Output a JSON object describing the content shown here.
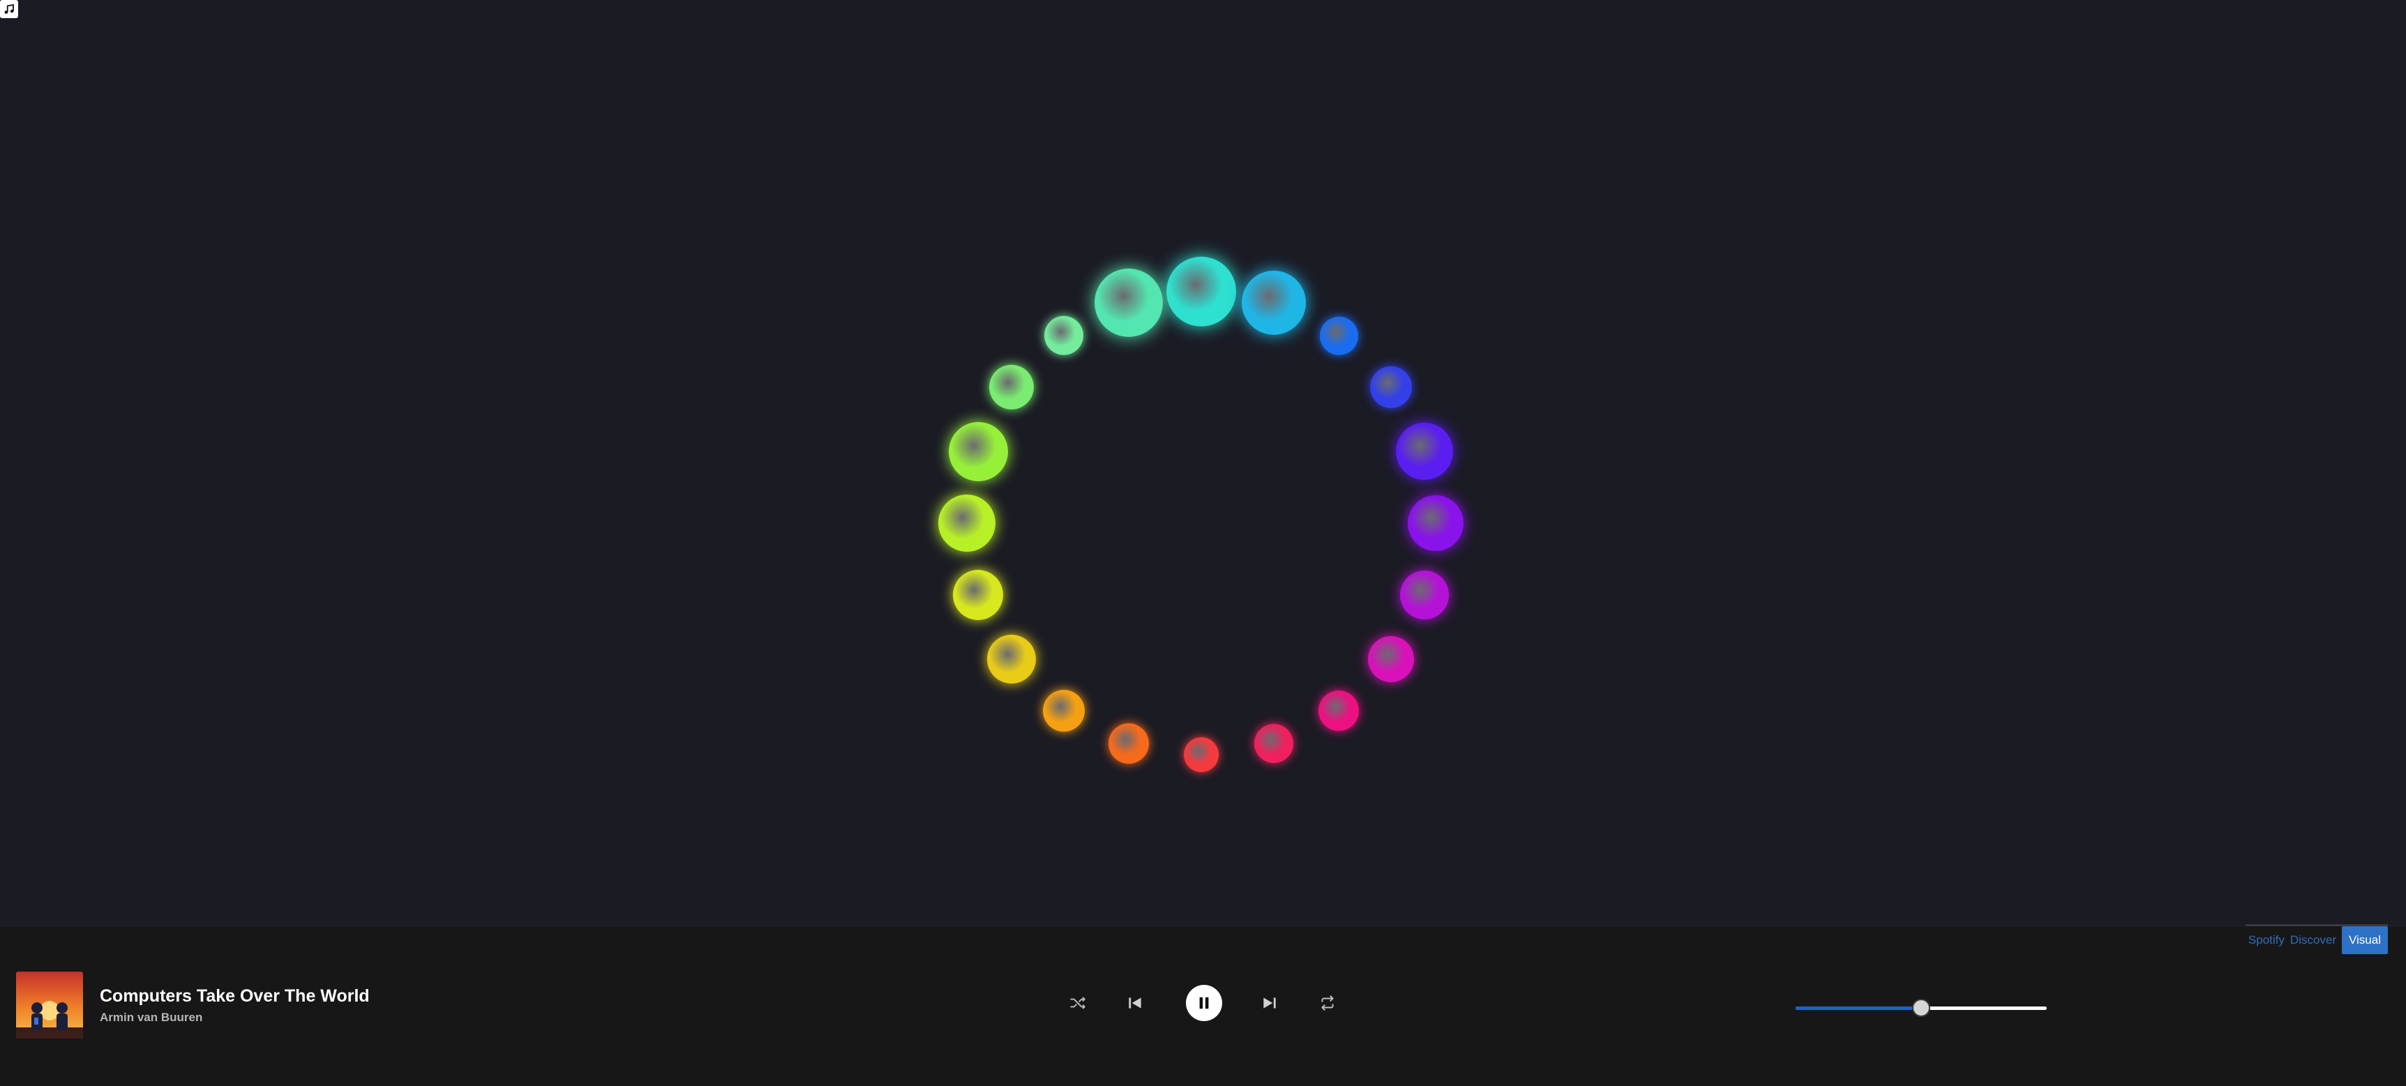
{
  "tabs": [
    {
      "label": "Spotify",
      "active": false
    },
    {
      "label": "Discover",
      "active": false
    },
    {
      "label": "Visual",
      "active": true
    }
  ],
  "now_playing": {
    "title": "Computers Take Over The World",
    "artist": "Armin van Buuren",
    "cover_icon": "album-cover"
  },
  "controls": {
    "shuffle_icon": "shuffle-icon",
    "prev_icon": "skip-previous-icon",
    "play_state_icon": "pause-icon",
    "next_icon": "skip-next-icon",
    "repeat_icon": "repeat-icon"
  },
  "volume": {
    "level": 0.5
  },
  "visualizer": {
    "orbs": [
      {
        "color": "#2ee0d0",
        "scale": 1.0
      },
      {
        "color": "#1fb6e6",
        "scale": 0.92
      },
      {
        "color": "#1a6df0",
        "scale": 0.55
      },
      {
        "color": "#3340e8",
        "scale": 0.6
      },
      {
        "color": "#5a1ef0",
        "scale": 0.82
      },
      {
        "color": "#8a12ea",
        "scale": 0.8
      },
      {
        "color": "#b512d8",
        "scale": 0.7
      },
      {
        "color": "#d812b8",
        "scale": 0.66
      },
      {
        "color": "#ec1080",
        "scale": 0.58
      },
      {
        "color": "#f0205e",
        "scale": 0.56
      },
      {
        "color": "#f53a3e",
        "scale": 0.5
      },
      {
        "color": "#f66a1c",
        "scale": 0.58
      },
      {
        "color": "#f4a012",
        "scale": 0.6
      },
      {
        "color": "#e8cc18",
        "scale": 0.7
      },
      {
        "color": "#d8e81e",
        "scale": 0.72
      },
      {
        "color": "#b8f028",
        "scale": 0.82
      },
      {
        "color": "#96f03a",
        "scale": 0.85
      },
      {
        "color": "#7aec70",
        "scale": 0.64
      },
      {
        "color": "#74ec9c",
        "scale": 0.56
      },
      {
        "color": "#54e6b0",
        "scale": 0.98
      }
    ]
  },
  "colors": {
    "background": "#1b1b24",
    "player_bar": "#171717",
    "accent": "#2d72c7"
  }
}
